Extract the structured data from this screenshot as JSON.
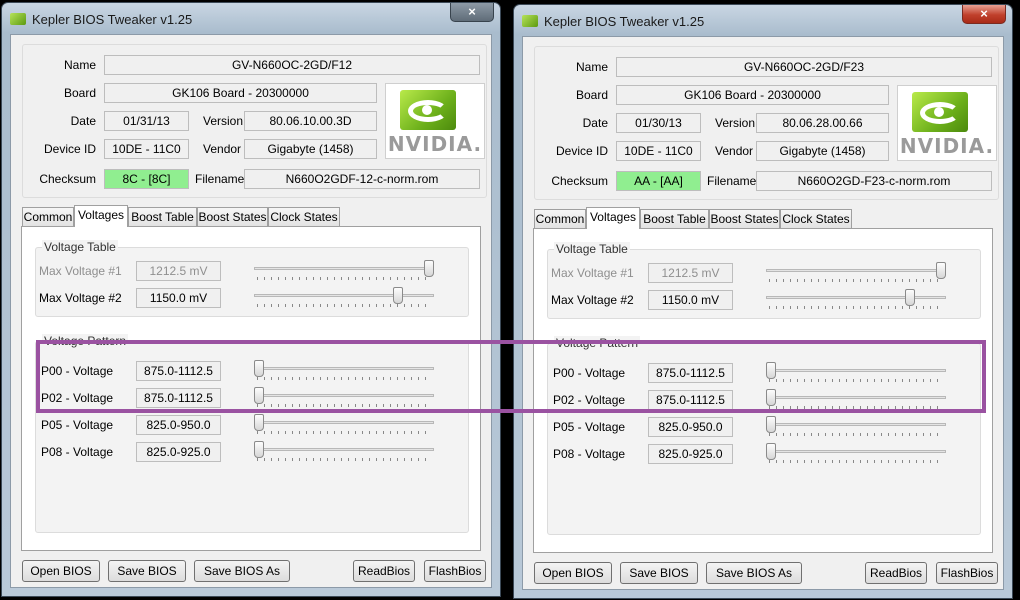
{
  "windows": [
    {
      "title": "Kepler BIOS Tweaker v1.25",
      "close_glyph": "×",
      "info": {
        "name_label": "Name",
        "name": "GV-N660OC-2GD/F12",
        "board_label": "Board",
        "board": "GK106 Board - 20300000",
        "date_label": "Date",
        "date": "01/31/13",
        "version_label": "Version",
        "version": "80.06.10.00.3D",
        "device_id_label": "Device ID",
        "device_id": "10DE - 11C0",
        "vendor_label": "Vendor",
        "vendor": "Gigabyte (1458)",
        "checksum_label": "Checksum",
        "checksum": "8C - [8C]",
        "filename_label": "Filename",
        "filename": "N660O2GDF-12-c-norm.rom",
        "logo_text": "NVIDIA."
      },
      "tabs": [
        "Common",
        "Voltages",
        "Boost Table",
        "Boost States",
        "Clock States"
      ],
      "active_tab": "Voltages",
      "voltage_table": {
        "title": "Voltage Table",
        "rows": [
          {
            "label": "Max Voltage #1",
            "value": "1212.5 mV",
            "enabled": false,
            "slider": 1.0
          },
          {
            "label": "Max Voltage #2",
            "value": "1150.0 mV",
            "enabled": true,
            "slider": 0.82
          }
        ]
      },
      "voltage_pattern": {
        "title": "Voltage Pattern",
        "rows": [
          {
            "label": "P00 - Voltage",
            "value": "875.0-1112.5",
            "slider": 0.0
          },
          {
            "label": "P02 - Voltage",
            "value": "875.0-1112.5",
            "slider": 0.0
          },
          {
            "label": "P05 - Voltage",
            "value": "825.0-950.0",
            "slider": 0.0
          },
          {
            "label": "P08 - Voltage",
            "value": "825.0-925.0",
            "slider": 0.0
          }
        ]
      },
      "buttons": {
        "open": "Open BIOS",
        "save": "Save BIOS",
        "save_as": "Save BIOS As",
        "read": "ReadBios",
        "flash": "FlashBios"
      }
    },
    {
      "title": "Kepler BIOS Tweaker v1.25",
      "close_glyph": "×",
      "info": {
        "name_label": "Name",
        "name": "GV-N660OC-2GD/F23",
        "board_label": "Board",
        "board": "GK106 Board - 20300000",
        "date_label": "Date",
        "date": "01/30/13",
        "version_label": "Version",
        "version": "80.06.28.00.66",
        "device_id_label": "Device ID",
        "device_id": "10DE - 11C0",
        "vendor_label": "Vendor",
        "vendor": "Gigabyte (1458)",
        "checksum_label": "Checksum",
        "checksum": "AA - [AA]",
        "filename_label": "Filename",
        "filename": "N660O2GD-F23-c-norm.rom",
        "logo_text": "NVIDIA."
      },
      "tabs": [
        "Common",
        "Voltages",
        "Boost Table",
        "Boost States",
        "Clock States"
      ],
      "active_tab": "Voltages",
      "voltage_table": {
        "title": "Voltage Table",
        "rows": [
          {
            "label": "Max Voltage #1",
            "value": "1212.5 mV",
            "enabled": false,
            "slider": 1.0
          },
          {
            "label": "Max Voltage #2",
            "value": "1150.0 mV",
            "enabled": true,
            "slider": 0.82
          }
        ]
      },
      "voltage_pattern": {
        "title": "Voltage Pattern",
        "rows": [
          {
            "label": "P00 - Voltage",
            "value": "875.0-1112.5",
            "slider": 0.0
          },
          {
            "label": "P02 - Voltage",
            "value": "875.0-1112.5",
            "slider": 0.0
          },
          {
            "label": "P05 - Voltage",
            "value": "825.0-950.0",
            "slider": 0.0
          },
          {
            "label": "P08 - Voltage",
            "value": "825.0-925.0",
            "slider": 0.0
          }
        ]
      },
      "buttons": {
        "open": "Open BIOS",
        "save": "Save BIOS",
        "save_as": "Save BIOS As",
        "read": "ReadBios",
        "flash": "FlashBios"
      }
    }
  ],
  "colors": {
    "checksum_ok": "#90ee90",
    "nvidia_green": "#76b900",
    "highlight": "#9a52a1",
    "close_active": "#c0402c"
  },
  "icons": {
    "app": "nvidia-eye-icon",
    "close": "close-icon"
  }
}
